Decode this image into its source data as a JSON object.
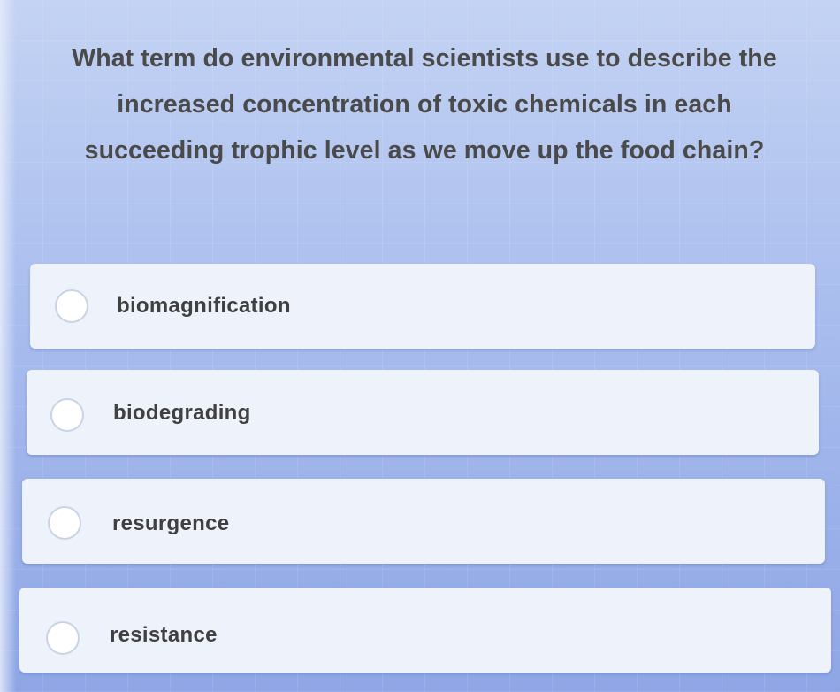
{
  "question": {
    "text": "What term do environmental scientists use to describe the increased concentration of toxic chemicals in each succeeding trophic level as we move up the food chain?"
  },
  "options": [
    {
      "label": "biomagnification",
      "selected": false
    },
    {
      "label": "biodegrading",
      "selected": false
    },
    {
      "label": "resurgence",
      "selected": false
    },
    {
      "label": "resistance",
      "selected": false
    }
  ],
  "colors": {
    "background": "#a9bdee",
    "option_card": "#eef3fb",
    "text": "#404040"
  }
}
